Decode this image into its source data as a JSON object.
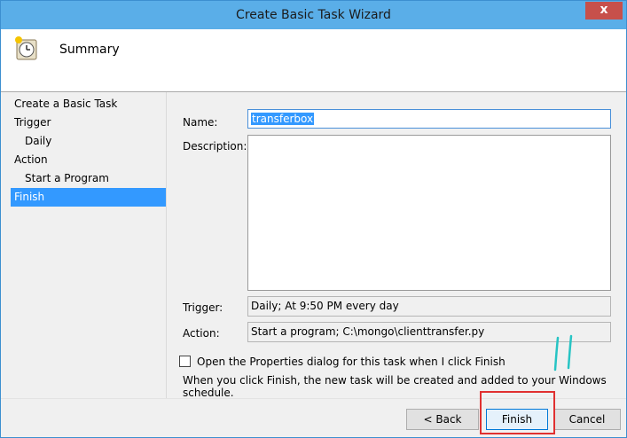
{
  "window": {
    "title": "Create Basic Task Wizard",
    "close_label": "x"
  },
  "header": {
    "title": "Summary",
    "icon": "clock-task-icon"
  },
  "steps": [
    {
      "label": "Create a Basic Task"
    },
    {
      "label": "Trigger"
    },
    {
      "label": "Daily"
    },
    {
      "label": "Action"
    },
    {
      "label": "Start a Program"
    },
    {
      "label": "Finish"
    }
  ],
  "form": {
    "name_label": "Name:",
    "name_value": "transferbox",
    "description_label": "Description:",
    "description_value": "",
    "trigger_label": "Trigger:",
    "trigger_value": "Daily; At 9:50 PM every day",
    "action_label": "Action:",
    "action_value": "Start a program; C:\\mongo\\clienttransfer.py",
    "checkbox_label": "Open the Properties dialog for this task when I click Finish",
    "info_text": "When you click Finish, the new task will be created and added to your Windows schedule."
  },
  "buttons": {
    "back": "< Back",
    "finish": "Finish",
    "cancel": "Cancel"
  },
  "colors": {
    "accent": "#3399ff",
    "highlight_box": "#e03030",
    "annotation": "#27c4c4"
  }
}
